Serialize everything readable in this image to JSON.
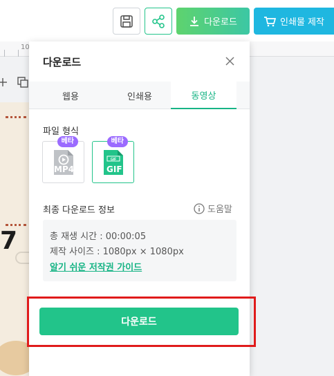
{
  "toolbar": {
    "download_label": "다운로드",
    "print_label": "인쇄물 제작"
  },
  "ruler": {
    "marker": "10"
  },
  "canvas": {
    "big_text": "7"
  },
  "panel": {
    "title": "다운로드",
    "tabs": [
      {
        "label": "웹용",
        "active": false
      },
      {
        "label": "인쇄용",
        "active": false
      },
      {
        "label": "동영상",
        "active": true
      }
    ],
    "file_format_label": "파일 형식",
    "formats": [
      {
        "label": "MP4",
        "badge": "베타",
        "selected": false
      },
      {
        "label": "GIF",
        "badge": "베타",
        "selected": true
      }
    ],
    "info_title": "최종 다운로드 정보",
    "help_label": "도움말",
    "info": {
      "duration": "총 재생 시간 : 00:00:05",
      "size": "제작 사이즈 : 1080px × 1080px",
      "guide_link": "알기 쉬운 저작권 가이드"
    },
    "download_button": "다운로드"
  },
  "colors": {
    "accent_green": "#22c48a",
    "print_blue": "#1fb7e0",
    "beta_purple": "#9b6bff",
    "highlight_red": "#e01b1b"
  }
}
